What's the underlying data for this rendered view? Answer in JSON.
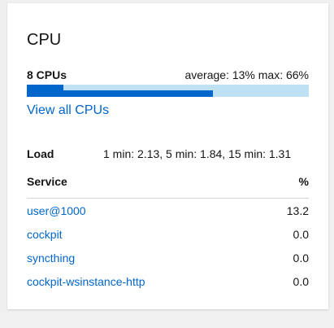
{
  "card": {
    "title": "CPU",
    "cpus_label": "8 CPUs",
    "usage_stats": "average: 13% max: 66%",
    "usage": {
      "average_fraction": 0.13,
      "max_fraction": 0.66
    },
    "view_all_label": "View all CPUs",
    "load": {
      "label": "Load",
      "value": "1 min: 2.13, 5 min: 1.84, 15 min: 1.31"
    },
    "table": {
      "headers": {
        "service": "Service",
        "percent": "%"
      },
      "rows": [
        {
          "service": "user@1000",
          "percent": "13.2"
        },
        {
          "service": "cockpit",
          "percent": "0.0"
        },
        {
          "service": "syncthing",
          "percent": "0.0"
        },
        {
          "service": "cockpit-wsinstance-http",
          "percent": "0.0"
        }
      ]
    }
  },
  "colors": {
    "accent": "#0066cc",
    "bar_track": "#bee1f4",
    "background": "#f0f0f0"
  }
}
